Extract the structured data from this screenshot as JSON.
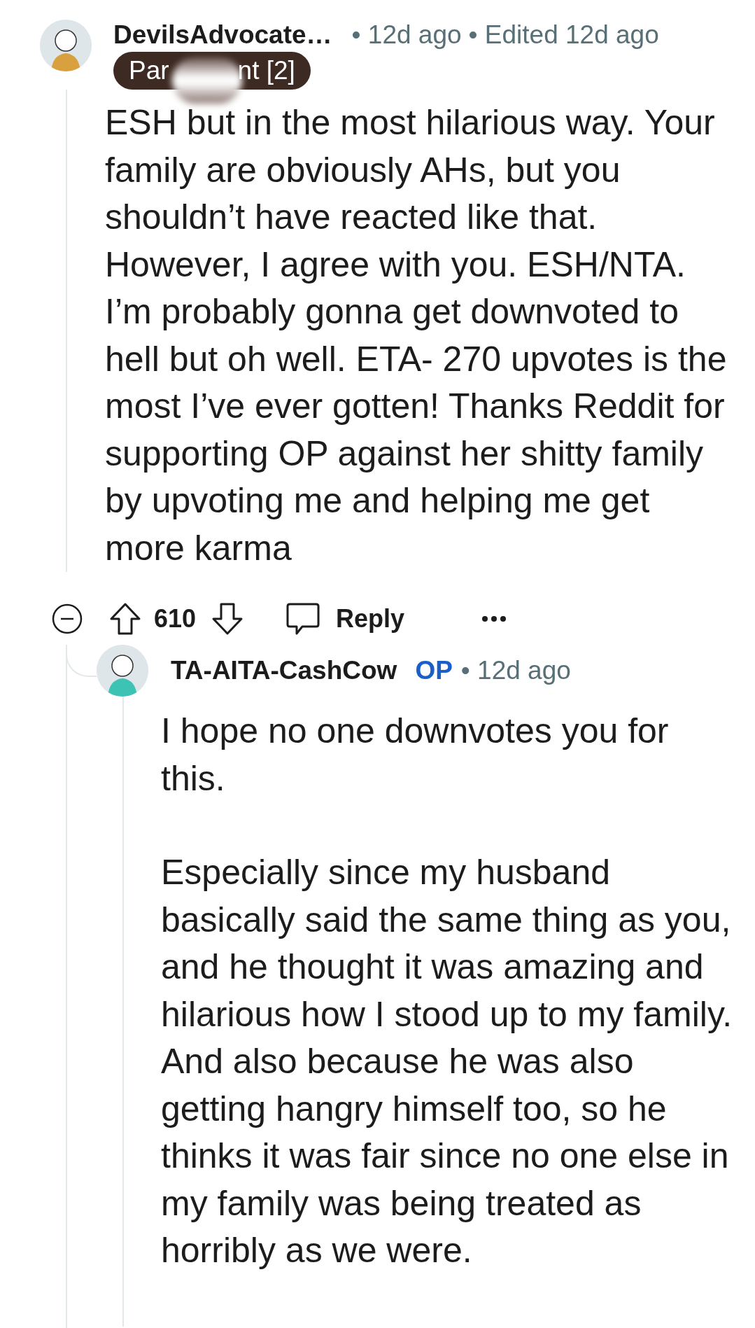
{
  "comment": {
    "author": "DevilsAdvocate…",
    "time": "• 12d ago",
    "edited": "• Edited 12d ago",
    "flair": {
      "start": "Par",
      "end": "nt [2]",
      "redacted": true
    },
    "body": [
      "ESH but in the most hilarious way. Your family are obviously AHs, but you shouldn’t have reacted like that. However, I agree with you. ESH/NTA. I’m probably gonna get downvoted to hell but oh well. ETA- 270 upvotes is the most I’ve ever gotten! Thanks Reddit for supporting OP against her shitty family by upvoting me and helping me get more karma"
    ],
    "votes": "610",
    "reply_label": "Reply"
  },
  "reply": {
    "author": "TA-AITA-CashCow",
    "badge": "OP",
    "time": "• 12d ago",
    "body": [
      "I hope no one downvotes you for this.",
      "Especially since my husband basically said the same thing as you, and he thought it was amazing and hilarious how I stood up to my family. And also because he was also getting hangry himself too, so he thinks it was fair since no one else in my family was being treated as horribly as we were."
    ]
  }
}
